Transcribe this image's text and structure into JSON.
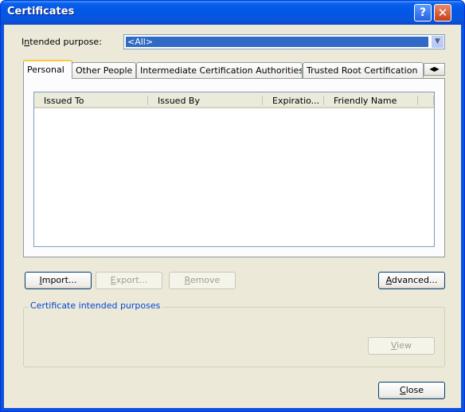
{
  "window": {
    "title": "Certificates"
  },
  "purpose": {
    "label_pre": "I",
    "label_accel": "n",
    "label_post": "tended purpose:",
    "value": "<All>"
  },
  "tabs": [
    {
      "label": "Personal",
      "active": true
    },
    {
      "label": "Other People"
    },
    {
      "label": "Intermediate Certification Authorities"
    },
    {
      "label": "Trusted Root Certification"
    }
  ],
  "list": {
    "columns": [
      "Issued To",
      "Issued By",
      "Expiratio...",
      "Friendly Name"
    ],
    "rows": []
  },
  "buttons": {
    "import": {
      "accel": "I",
      "rest": "mport..."
    },
    "export": {
      "accel": "E",
      "rest": "xport..."
    },
    "remove": {
      "accel": "R",
      "rest": "emove"
    },
    "advanced": {
      "accel": "A",
      "rest": "dvanced..."
    },
    "view": {
      "accel": "V",
      "rest": "iew"
    },
    "close": {
      "accel": "C",
      "rest": "lose"
    }
  },
  "group": {
    "title": "Certificate intended purposes"
  }
}
